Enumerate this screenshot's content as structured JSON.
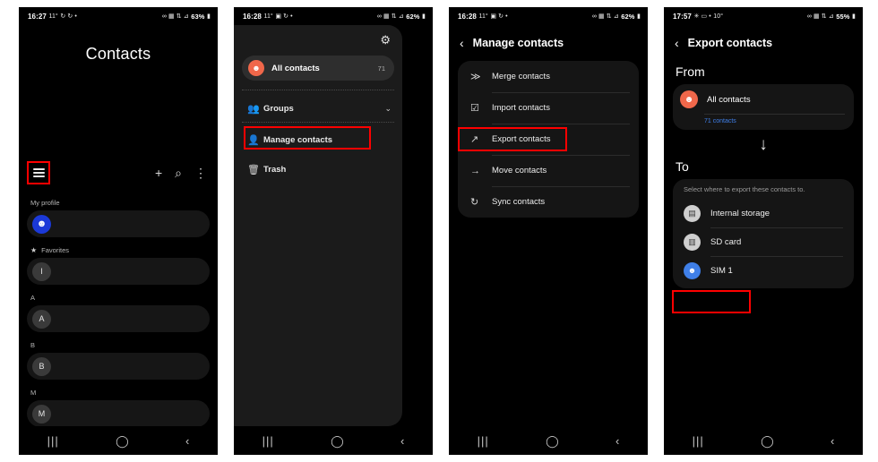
{
  "screens": [
    {
      "id": "contacts-home",
      "status": {
        "time": "16:27",
        "temp": "11°",
        "left_icons": "↻ ↻ •",
        "right_icons": "∞ ▦ ⇅ ⊿",
        "battery": "63%"
      },
      "title": "Contacts",
      "actions": {
        "menu": "hamburger-menu",
        "add": "+",
        "search": "⌕",
        "more": "⋮"
      },
      "sections": [
        {
          "label": "My profile",
          "icon": "",
          "row": {
            "initial": "",
            "avatar": "profile"
          }
        },
        {
          "label": "Favorites",
          "icon": "★",
          "row": {
            "initial": "I",
            "avatar": "plain"
          }
        },
        {
          "label": "A",
          "icon": "",
          "row": {
            "initial": "A",
            "avatar": "plain"
          }
        },
        {
          "label": "B",
          "icon": "",
          "row": {
            "initial": "B",
            "avatar": "plain"
          }
        },
        {
          "label": "M",
          "icon": "",
          "row": {
            "initial": "M",
            "avatar": "plain"
          }
        }
      ],
      "nav": {
        "recents": "|||",
        "home": "◯",
        "back": "‹"
      }
    },
    {
      "id": "nav-drawer",
      "status": {
        "time": "16:28",
        "temp": "11°",
        "left_icons": "▣ ↻ •",
        "right_icons": "∞ ▦ ⇅ ⊿",
        "battery": "62%"
      },
      "settings_icon": "⚙",
      "all_contacts": {
        "label": "All contacts",
        "count": "71"
      },
      "items": [
        {
          "label": "Groups",
          "icon": "👥",
          "chevron": "⌄"
        },
        {
          "label": "Manage contacts",
          "icon": "👤",
          "chevron": ""
        },
        {
          "label": "Trash",
          "icon": "🗑",
          "chevron": ""
        }
      ],
      "highlighted": "Manage contacts",
      "nav": {
        "recents": "|||",
        "home": "◯",
        "back": "‹"
      }
    },
    {
      "id": "manage-contacts",
      "status": {
        "time": "16:28",
        "temp": "11°",
        "left_icons": "▣ ↻ •",
        "right_icons": "∞ ▦ ⇅ ⊿",
        "battery": "62%"
      },
      "back_icon": "‹",
      "title": "Manage contacts",
      "items": [
        {
          "label": "Merge contacts",
          "icon": "≫"
        },
        {
          "label": "Import contacts",
          "icon": "☑"
        },
        {
          "label": "Export contacts",
          "icon": "↗"
        },
        {
          "label": "Move contacts",
          "icon": "→"
        },
        {
          "label": "Sync contacts",
          "icon": "↻"
        }
      ],
      "highlighted": "Export contacts",
      "nav": {
        "recents": "|||",
        "home": "◯",
        "back": "‹"
      }
    },
    {
      "id": "export-contacts",
      "status": {
        "time": "17:57",
        "temp": "10°",
        "left_icons": "✳ ▭ •",
        "right_icons": "∞ ▦ ⇅ ⊿",
        "battery": "55%"
      },
      "back_icon": "‹",
      "title": "Export contacts",
      "from_label": "From",
      "from": {
        "name": "All contacts",
        "subtitle": "71 contacts"
      },
      "arrow": "↓",
      "to_label": "To",
      "to_hint": "Select where to export these contacts to.",
      "destinations": [
        {
          "label": "Internal storage",
          "icon": "▤",
          "kind": "storage"
        },
        {
          "label": "SD card",
          "icon": "▥",
          "kind": "storage"
        },
        {
          "label": "SIM 1",
          "icon": "👤",
          "kind": "sim"
        }
      ],
      "highlighted": "SIM 1",
      "nav": {
        "recents": "|||",
        "home": "◯",
        "back": "‹"
      }
    }
  ],
  "colors": {
    "highlight": "#ff0000",
    "accent_blue": "#3f7fe8",
    "avatar_coral": "#f0674a",
    "profile_blue": "#1b39d8",
    "screen_bg": "#000000",
    "card_bg": "#151515"
  }
}
